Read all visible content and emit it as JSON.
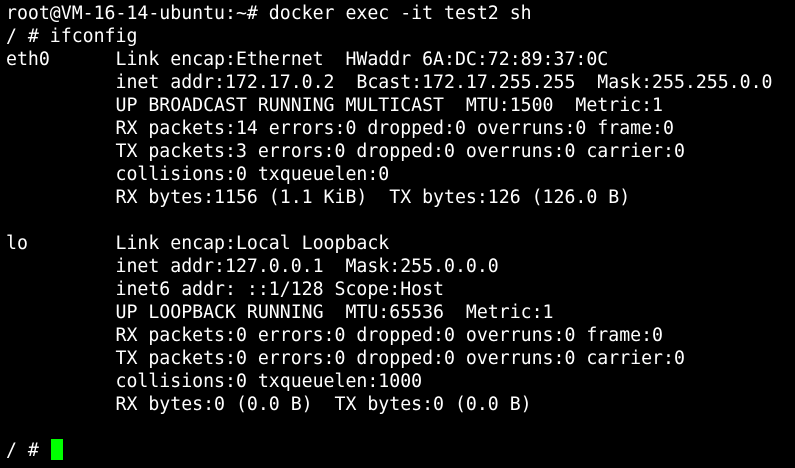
{
  "terminal": {
    "lines": [
      "root@VM-16-14-ubuntu:~# docker exec -it test2 sh",
      "/ # ifconfig",
      "eth0      Link encap:Ethernet  HWaddr 6A:DC:72:89:37:0C",
      "          inet addr:172.17.0.2  Bcast:172.17.255.255  Mask:255.255.0.0",
      "          UP BROADCAST RUNNING MULTICAST  MTU:1500  Metric:1",
      "          RX packets:14 errors:0 dropped:0 overruns:0 frame:0",
      "          TX packets:3 errors:0 dropped:0 overruns:0 carrier:0",
      "          collisions:0 txqueuelen:0",
      "          RX bytes:1156 (1.1 KiB)  TX bytes:126 (126.0 B)",
      "",
      "lo        Link encap:Local Loopback",
      "          inet addr:127.0.0.1  Mask:255.0.0.0",
      "          inet6 addr: ::1/128 Scope:Host",
      "          UP LOOPBACK RUNNING  MTU:65536  Metric:1",
      "          RX packets:0 errors:0 dropped:0 overruns:0 frame:0",
      "          TX packets:0 errors:0 dropped:0 overruns:0 carrier:0",
      "          collisions:0 txqueuelen:1000",
      "          RX bytes:0 (0.0 B)  TX bytes:0 (0.0 B)",
      ""
    ],
    "prompt": "/ # ",
    "colors": {
      "background": "#000000",
      "foreground": "#ffffff",
      "cursor": "#00ff00"
    }
  }
}
